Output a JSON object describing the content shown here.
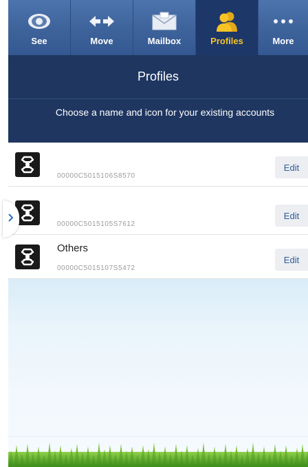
{
  "tabs": [
    {
      "label": "See",
      "icon": "eye-icon",
      "active": false
    },
    {
      "label": "Move",
      "icon": "transfer-arrows-icon",
      "active": false
    },
    {
      "label": "Mailbox",
      "icon": "envelope-icon",
      "active": false
    },
    {
      "label": "Profiles",
      "icon": "people-icon",
      "active": true
    },
    {
      "label": "More",
      "icon": "more-dots-icon",
      "active": false
    }
  ],
  "header": {
    "title": "Profiles",
    "subtitle": "Choose a name and icon for your existing accounts"
  },
  "accounts": [
    {
      "name": "",
      "number": "00000C5015106S8570",
      "edit_label": "Edit",
      "icon": "bank-logo-icon"
    },
    {
      "name": "",
      "number": "00000C5015105S7612",
      "edit_label": "Edit",
      "icon": "bank-logo-icon"
    },
    {
      "name": "Others",
      "number": "00000C5015107S5472",
      "edit_label": "Edit",
      "icon": "bank-logo-icon"
    }
  ],
  "colors": {
    "tab_bar": "#3f649c",
    "tab_active_bg": "#1d3768",
    "tab_active_text": "#f7c326",
    "header_bg": "#1e3660",
    "edit_text": "#2e5c99",
    "grass": "#5fb02c"
  },
  "drawer_handle_icon": "chevron-right-icon"
}
